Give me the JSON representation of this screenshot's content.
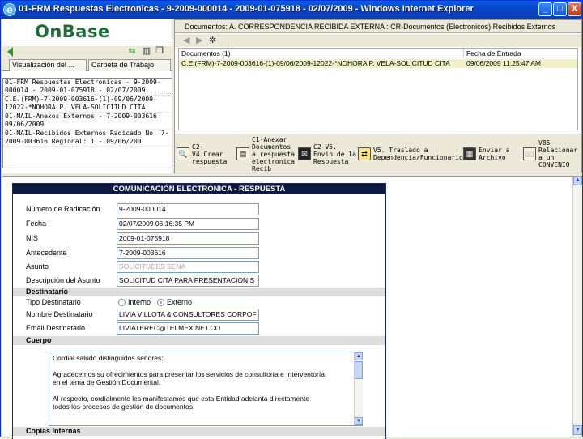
{
  "window": {
    "title": "01-FRM Respuestas Electronicas - 9-2009-000014 - 2009-01-075918 - 02/07/2009 - Windows Internet Explorer",
    "minimize": "_",
    "maximize": "□",
    "close": "X"
  },
  "left": {
    "logo": "OnBase",
    "tabs": [
      "Visualización del ...",
      "Carpeta de Trabajo"
    ],
    "items": [
      "01-FRM Respuestas Electronicas - 9-2009-000014 - 2009-01-075918 - 02/07/2009",
      "C.E.(FRM)-7-2009-003616-(1)-09/06/2009-12022-*NOHORA P. VELA-SOLICITUD CITA",
      "01-MAIL-Anexos Externos - 7-2009-003616 09/06/2009",
      "01-MAIL-Recibidos Externos Radicado No. 7-2009-003616 Regional: 1 - 09/06/200"
    ]
  },
  "right": {
    "header": "Documentos: A. CORRESPONDENCIA RECIBIDA EXTERNA : CR-Documentos (Electronicos) Recibidos Externos",
    "columns": [
      "Documentos (1)",
      "Fecha de Entrada"
    ],
    "rows": [
      {
        "doc": "C.E.(FRM)-7-2009-003616-(1)-09/06/2009-12022-*NOHORA P. VELA-SOLICITUD CITA",
        "date": "09/06/2009 11:25:47 AM"
      }
    ],
    "actions": [
      {
        "label": "C2-\nV4.Crear\nrespuesta"
      },
      {
        "label": "C1-Anexar\nDocumentos\na respuesta\nelectronica\nRecib"
      },
      {
        "label": "C2-V5.\nEnvio de la\nRespuesta"
      },
      {
        "label": "V5. Traslado a\nDependencia/Funcionario"
      },
      {
        "label": "Enviar a\nArchivo"
      },
      {
        "label": "V85\nRelacionar\na un\nCONVENIO"
      }
    ]
  },
  "form": {
    "title": "COMUNICACIÓN ELECTRÓNICA - RESPUESTA",
    "fields": [
      {
        "label": "Número de Radicación",
        "value": "9-2009-000014"
      },
      {
        "label": "Fecha",
        "value": "02/07/2009 06:16:35 PM"
      },
      {
        "label": "NIS",
        "value": "2009-01-075918"
      },
      {
        "label": "Antecedente",
        "value": "7-2009-003616"
      },
      {
        "label": "Asunto",
        "value": "SOLICITUDES SENA"
      },
      {
        "label": "Descripción del Asunto",
        "value": "SOLICITUD CITA PARA PRESENTACION S"
      }
    ],
    "destinatario_section": "Destinatario",
    "tipo_label": "Tipo Destinatario",
    "tipo_options": [
      "Interno",
      "Externo"
    ],
    "tipo_selected": "Externo",
    "nombre_label": "Nombre Destinatario",
    "nombre_value": "LIVIA VILLOTA & CONSULTORES CORPOF",
    "email_label": "Email Destinatario",
    "email_value": "LIVIATEREC@TELMEX.NET.CO",
    "cuerpo_section": "Cuerpo",
    "cuerpo_text": "Cordial saludo distinguidos señores:\n\nAgradecemos su ofrecimientos para presentar los servicios de consultoría e Interventoría\nen el tema de Gestión Documental.\n\nAl respecto, cordialmente les manifestamos que esta Entidad adelanta directamente\ntodos los procesos de gestión de documentos.",
    "copias_section": "Copias Internas"
  }
}
